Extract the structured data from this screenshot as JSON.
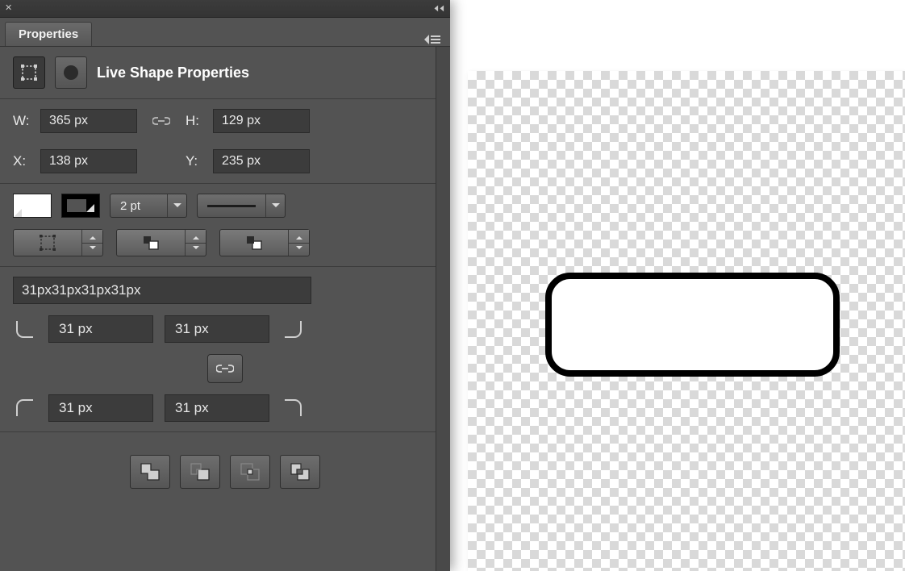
{
  "tab": {
    "label": "Properties"
  },
  "header": {
    "title": "Live Shape Properties"
  },
  "dims": {
    "w_label": "W:",
    "h_label": "H:",
    "x_label": "X:",
    "y_label": "Y:",
    "w": "365 px",
    "h": "129 px",
    "x": "138 px",
    "y": "235 px"
  },
  "stroke": {
    "weight": "2 pt"
  },
  "corners": {
    "combined": "31px31px31px31px",
    "tl": "31 px",
    "tr": "31 px",
    "bl": "31 px",
    "br": "31 px"
  }
}
